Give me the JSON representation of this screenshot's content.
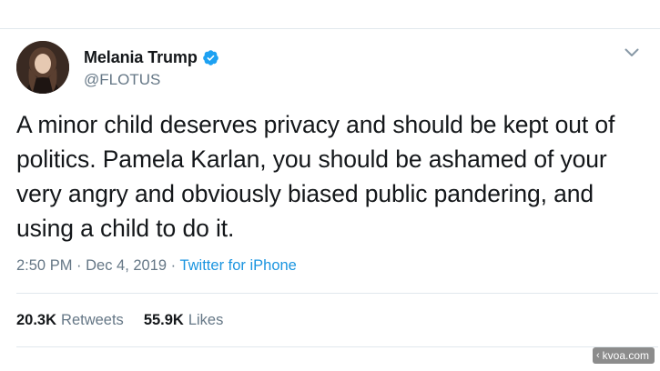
{
  "author": {
    "display_name": "Melania Trump",
    "handle": "@FLOTUS",
    "verified": true
  },
  "tweet": {
    "text": "A minor child deserves privacy and should be kept out of politics. Pamela Karlan, you should be ashamed of your very angry and obviously biased public pandering, and using a child to do it.",
    "timestamp": "2:50 PM · Dec 4, 2019",
    "separator": " · ",
    "source": "Twitter for iPhone"
  },
  "stats": {
    "retweets_count": "20.3K",
    "retweets_label": "Retweets",
    "likes_count": "55.9K",
    "likes_label": "Likes"
  },
  "watermark": {
    "chevron": "‹",
    "text": "kvoa.com"
  },
  "icons": {
    "verified": "verified-badge-icon",
    "caret": "chevron-down-icon"
  },
  "colors": {
    "text_primary": "#14171a",
    "text_secondary": "#657786",
    "link": "#1b95e0",
    "verified": "#1da1f2",
    "divider": "#e1e8ed"
  }
}
